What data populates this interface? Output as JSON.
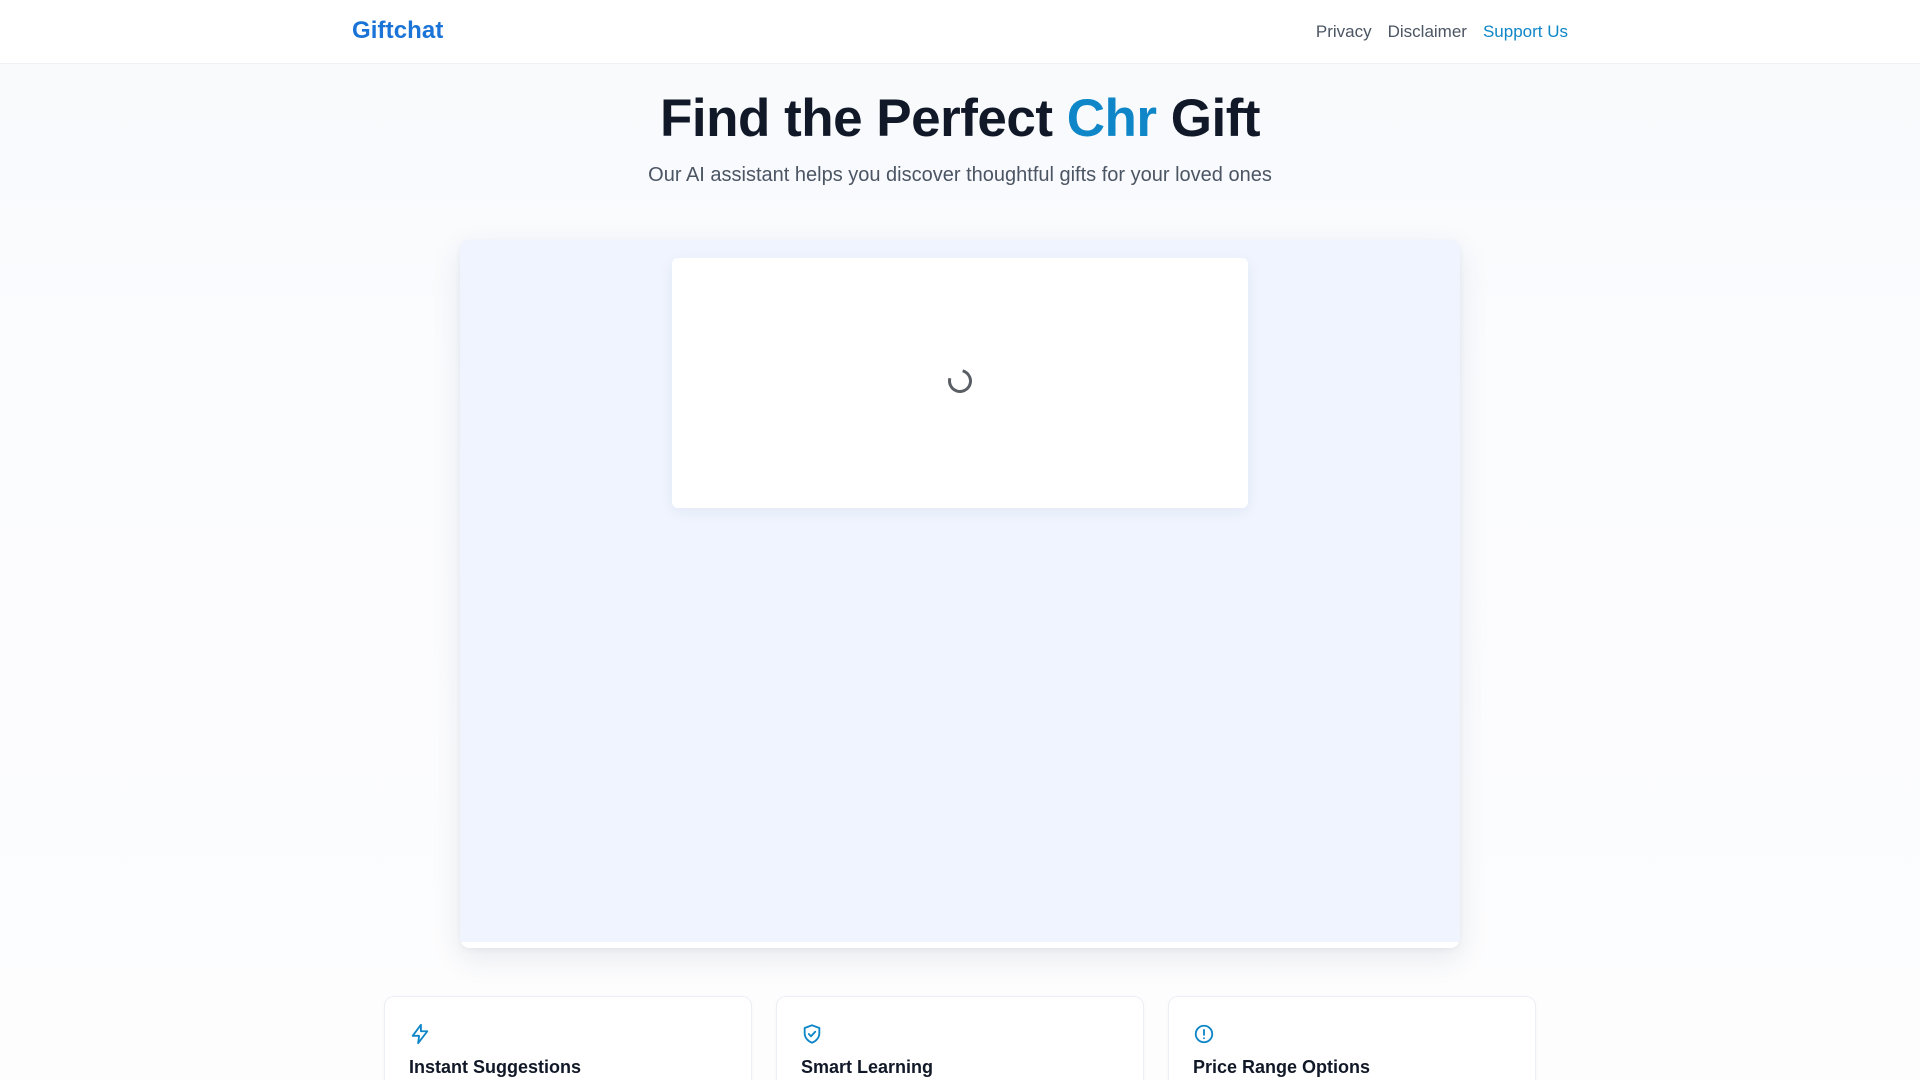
{
  "header": {
    "logo": "Giftchat",
    "nav": [
      {
        "label": "Privacy"
      },
      {
        "label": "Disclaimer"
      },
      {
        "label": "Support Us"
      }
    ]
  },
  "hero": {
    "title_start": "Find the Perfect ",
    "title_accent": "Chr",
    "title_end": " Gift",
    "subtitle": "Our AI assistant helps you discover thoughtful gifts for your loved ones"
  },
  "chat": {
    "status_icon": "loading-spinner"
  },
  "features": [
    {
      "icon": "lightning-icon",
      "title": "Instant Suggestions"
    },
    {
      "icon": "shield-check-icon",
      "title": "Smart Learning"
    },
    {
      "icon": "alert-circle-icon",
      "title": "Price Range Options"
    }
  ],
  "colors": {
    "brand": "#1a73d6",
    "accent": "#0e86c7",
    "text_primary": "#111827",
    "text_secondary": "#4b5563",
    "chat_background": "#eff4fe"
  }
}
